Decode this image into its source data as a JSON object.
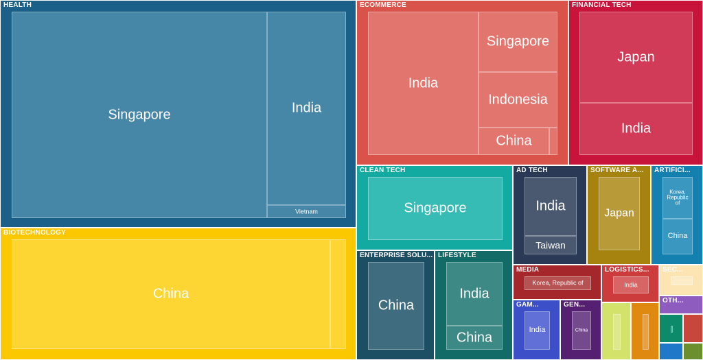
{
  "chart_data": {
    "type": "treemap",
    "sectors": [
      {
        "name": "HEALTH",
        "color": "#1b6088",
        "children": [
          {
            "name": "Singapore",
            "color": "#4686a6"
          },
          {
            "name": "India",
            "color": "#4686a6"
          },
          {
            "name": "Vietnam",
            "color": "#4686a6"
          }
        ]
      },
      {
        "name": "BIOTECHNOLOGY",
        "color": "#fbc800",
        "children": [
          {
            "name": "China",
            "color": "#fdd634"
          },
          {
            "name": "",
            "color": "#fdd634"
          }
        ]
      },
      {
        "name": "ECOMMERCE",
        "color": "#d9534a",
        "children": [
          {
            "name": "India",
            "color": "#e2766f"
          },
          {
            "name": "Singapore",
            "color": "#e2766f"
          },
          {
            "name": "Indonesia",
            "color": "#e2766f"
          },
          {
            "name": "China",
            "color": "#e2766f"
          },
          {
            "name": "",
            "color": "#e2766f"
          }
        ]
      },
      {
        "name": "FINANCIAL TECH",
        "color": "#c8143a",
        "children": [
          {
            "name": "Japan",
            "color": "#d23b57"
          },
          {
            "name": "India",
            "color": "#d23b57"
          }
        ]
      },
      {
        "name": "CLEAN TECH",
        "color": "#13aba1",
        "children": [
          {
            "name": "Singapore",
            "color": "#36bcb5"
          }
        ]
      },
      {
        "name": "AD TECH",
        "color": "#2a3a56",
        "children": [
          {
            "name": "India",
            "color": "#4a5870"
          },
          {
            "name": "Taiwan",
            "color": "#4a5870"
          }
        ]
      },
      {
        "name": "SOFTWARE A...",
        "color": "#a6820e",
        "children": [
          {
            "name": "Japan",
            "color": "#b89a38"
          }
        ]
      },
      {
        "name": "ARTIFICI...",
        "color": "#1480b0",
        "children": [
          {
            "name": "Korea, Republic of",
            "color": "#3a97c0"
          },
          {
            "name": "China",
            "color": "#3a97c0"
          }
        ]
      },
      {
        "name": "ENTERPRISE SOLU...",
        "color": "#1c4f64",
        "children": [
          {
            "name": "China",
            "color": "#406c80"
          }
        ]
      },
      {
        "name": "LIFESTYLE",
        "color": "#136b68",
        "children": [
          {
            "name": "India",
            "color": "#3c8985"
          },
          {
            "name": "China",
            "color": "#3c8985"
          }
        ]
      },
      {
        "name": "MEDIA",
        "color": "#a5262b",
        "children": [
          {
            "name": "Korea, Republic of",
            "color": "#b75253"
          }
        ]
      },
      {
        "name": "LOGISTICS...",
        "color": "#cc3c3c",
        "children": [
          {
            "name": "India",
            "color": "#d76565"
          }
        ]
      },
      {
        "name": "SEC...",
        "color": "#fde5b3",
        "children": [
          {
            "name": "",
            "color": "#fdecc8"
          }
        ]
      },
      {
        "name": "OTH...",
        "color": "#8e5bbf",
        "children": []
      },
      {
        "name": "GAM...",
        "color": "#3c4fc8",
        "children": [
          {
            "name": "India",
            "color": "#6070d6"
          }
        ]
      },
      {
        "name": "GEN...",
        "color": "#552072",
        "children": [
          {
            "name": "China",
            "color": "#744a8d"
          }
        ]
      },
      {
        "name": "",
        "color": "#d3e26a",
        "children": [
          {
            "name": "",
            "color": "#dde88d"
          }
        ]
      },
      {
        "name": "",
        "color": "#e08910",
        "children": [
          {
            "name": "",
            "color": "#e9a040"
          }
        ]
      },
      {
        "name": "",
        "color": "#0c8a6a",
        "children": [
          {
            "name": "",
            "color": "#3aa081"
          }
        ]
      },
      {
        "name": "",
        "color": "#c8473d",
        "children": []
      },
      {
        "name": "",
        "color": "#1f78c8",
        "children": []
      },
      {
        "name": "",
        "color": "#6b8f2e",
        "children": []
      }
    ]
  }
}
